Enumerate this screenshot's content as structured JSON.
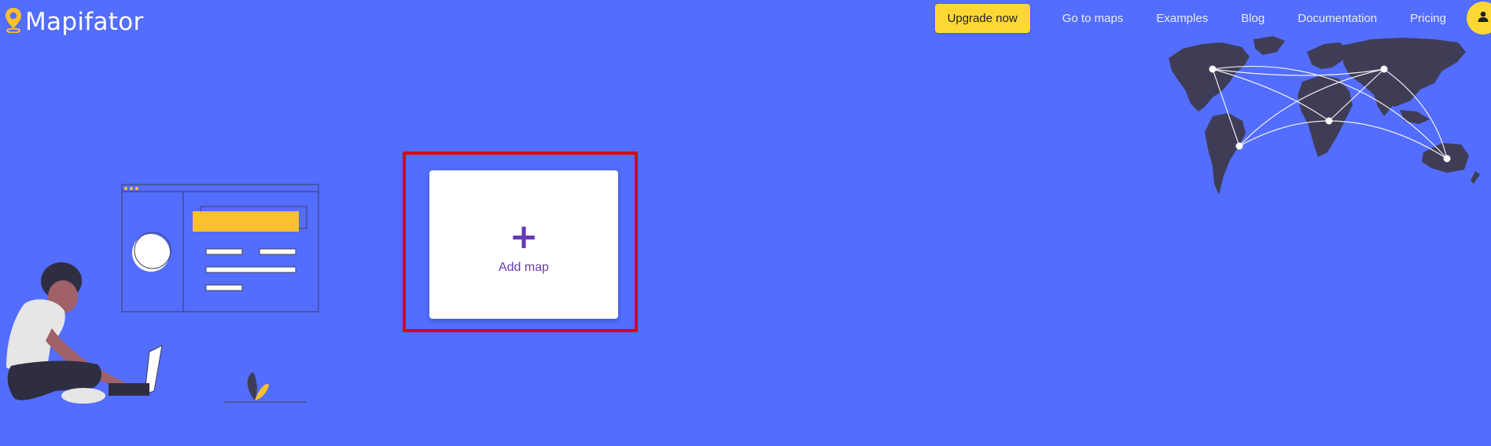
{
  "header": {
    "logo_text": "Mapifator",
    "logo_icon": "map-pin-icon",
    "upgrade_label": "Upgrade now",
    "nav_links": [
      "Go to maps",
      "Examples",
      "Blog",
      "Documentation",
      "Pricing"
    ],
    "account_icon": "person-icon"
  },
  "main": {
    "add_card": {
      "icon": "plus-icon",
      "label": "Add map"
    }
  },
  "colors": {
    "background": "#536dfe",
    "accent_yellow": "#fdd835",
    "card_text": "#673ab7",
    "highlight_border": "#e0000f"
  }
}
